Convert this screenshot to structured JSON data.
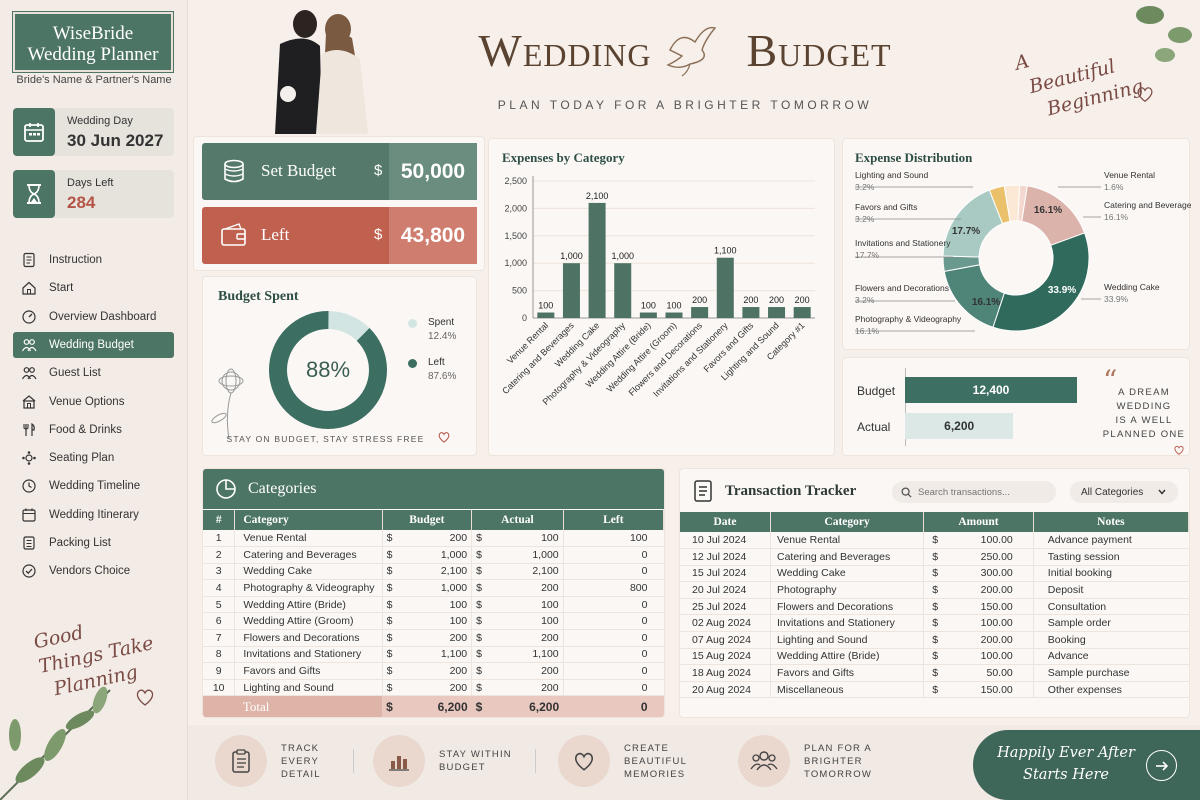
{
  "sidebar": {
    "brand_line1": "WiseBride",
    "brand_line2": "Wedding Planner",
    "names": "Bride's Name & Partner's Name",
    "wedding_day_label": "Wedding Day",
    "wedding_day_value": "30 Jun 2027",
    "days_left_label": "Days Left",
    "days_left_value": "284",
    "nav": [
      {
        "label": "Instruction",
        "icon": "document-icon"
      },
      {
        "label": "Start",
        "icon": "home-icon"
      },
      {
        "label": "Overview Dashboard",
        "icon": "dashboard-icon"
      },
      {
        "label": "Wedding Budget",
        "icon": "people-icon"
      },
      {
        "label": "Guest List",
        "icon": "guest-icon"
      },
      {
        "label": "Venue Options",
        "icon": "venue-icon"
      },
      {
        "label": "Food & Drinks",
        "icon": "cutlery-icon"
      },
      {
        "label": "Seating Plan",
        "icon": "seating-icon"
      },
      {
        "label": "Wedding Timeline",
        "icon": "clock-icon"
      },
      {
        "label": "Wedding Itinerary",
        "icon": "calendar-icon"
      },
      {
        "label": "Packing List",
        "icon": "list-icon"
      },
      {
        "label": "Vendors Choice",
        "icon": "check-icon"
      }
    ],
    "quote_lines": [
      "Good",
      "Things Take",
      "Planning"
    ]
  },
  "header": {
    "title_left": "Wedding",
    "title_right": "Budget",
    "subtitle": "PLAN TODAY FOR A BRIGHTER TOMORROW",
    "tagline_lines": [
      "A",
      "Beautiful",
      "Beginning"
    ]
  },
  "budget": {
    "set_label": "Set Budget",
    "set_currency": "$",
    "set_value": "50,000",
    "left_label": "Left",
    "left_currency": "$",
    "left_value": "43,800"
  },
  "budget_spent": {
    "title": "Budget Spent",
    "percent": "88%",
    "spent_label": "Spent",
    "spent_value": "12.4%",
    "left_label": "Left",
    "left_value": "87.6%",
    "footer": "STAY ON BUDGET, STAY STRESS FREE",
    "donut_fraction_main": 0.876
  },
  "expenses_chart": {
    "title": "Expenses by Category"
  },
  "distribution": {
    "title": "Expense Distribution",
    "left_labels": [
      {
        "name": "Lighting and Sound",
        "pct": "3.2%"
      },
      {
        "name": "Favors and Gifts",
        "pct": "3.2%"
      },
      {
        "name": "Invitations and Stationery",
        "pct": "17.7%"
      },
      {
        "name": "Flowers and Decorations",
        "pct": "3.2%"
      },
      {
        "name": "Photography & Videography",
        "pct": "16.1%"
      }
    ],
    "right_labels": [
      {
        "name": "Venue Rental",
        "pct": "1.6%"
      },
      {
        "name": "Catering and Beverages",
        "pct": "16.1%"
      },
      {
        "name": "Wedding Cake",
        "pct": "33.9%"
      }
    ],
    "inner_labels": [
      "16.1%",
      "17.7%",
      "16.1%",
      "33.9%"
    ]
  },
  "budget_actual": {
    "budget_label": "Budget",
    "budget_value": "12,400",
    "budget_fraction": 1.0,
    "actual_label": "Actual",
    "actual_value": "6,200",
    "actual_fraction": 0.5
  },
  "quote": {
    "lines": [
      "A DREAM",
      "WEDDING",
      "IS A WELL",
      "PLANNED ONE"
    ]
  },
  "categories": {
    "title": "Categories",
    "headers": [
      "#",
      "Category",
      "Budget",
      "Actual",
      "Left"
    ],
    "rows": [
      [
        "1",
        "Venue Rental",
        "$",
        "200",
        "$",
        "100",
        "100"
      ],
      [
        "2",
        "Catering and Beverages",
        "$",
        "1,000",
        "$",
        "1,000",
        "0"
      ],
      [
        "3",
        "Wedding Cake",
        "$",
        "2,100",
        "$",
        "2,100",
        "0"
      ],
      [
        "4",
        "Photography & Videography",
        "$",
        "1,000",
        "$",
        "200",
        "800"
      ],
      [
        "5",
        "Wedding Attire (Bride)",
        "$",
        "100",
        "$",
        "100",
        "0"
      ],
      [
        "6",
        "Wedding Attire (Groom)",
        "$",
        "100",
        "$",
        "100",
        "0"
      ],
      [
        "7",
        "Flowers and Decorations",
        "$",
        "200",
        "$",
        "200",
        "0"
      ],
      [
        "8",
        "Invitations and Stationery",
        "$",
        "1,100",
        "$",
        "1,100",
        "0"
      ],
      [
        "9",
        "Favors and Gifts",
        "$",
        "200",
        "$",
        "200",
        "0"
      ],
      [
        "10",
        "Lighting and Sound",
        "$",
        "200",
        "$",
        "200",
        "0"
      ]
    ],
    "total_label": "Total",
    "total_cur": "$",
    "total_budget": "6,200",
    "total_cur2": "$",
    "total_actual": "6,200",
    "total_left": "0"
  },
  "transactions": {
    "title": "Transaction Tracker",
    "search_placeholder": "Search transactions...",
    "filter_value": "All Categories",
    "headers": [
      "Date",
      "Category",
      "Amount",
      "Notes"
    ],
    "rows": [
      [
        "10 Jul 2024",
        "Venue Rental",
        "$",
        "100.00",
        "Advance payment"
      ],
      [
        "12 Jul 2024",
        "Catering and Beverages",
        "$",
        "250.00",
        "Tasting session"
      ],
      [
        "15 Jul 2024",
        "Wedding Cake",
        "$",
        "300.00",
        "Initial booking"
      ],
      [
        "20 Jul 2024",
        "Photography",
        "$",
        "200.00",
        "Deposit"
      ],
      [
        "25 Jul 2024",
        "Flowers and Decorations",
        "$",
        "150.00",
        "Consultation"
      ],
      [
        "02 Aug 2024",
        "Invitations and Stationery",
        "$",
        "100.00",
        "Sample order"
      ],
      [
        "07 Aug 2024",
        "Lighting and Sound",
        "$",
        "200.00",
        "Booking"
      ],
      [
        "15 Aug 2024",
        "Wedding Attire (Bride)",
        "$",
        "100.00",
        "Advance"
      ],
      [
        "18 Aug 2024",
        "Favors and Gifts",
        "$",
        "50.00",
        "Sample purchase"
      ],
      [
        "20 Aug 2024",
        "Miscellaneous",
        "$",
        "150.00",
        "Other expenses"
      ]
    ]
  },
  "footer": {
    "items": [
      {
        "line1": "TRACK EVERY",
        "line2": "DETAIL"
      },
      {
        "line1": "STAY WITHIN",
        "line2": "BUDGET"
      },
      {
        "line1": "CREATE BEAUTIFUL",
        "line2": "MEMORIES"
      },
      {
        "line1": "PLAN FOR A BRIGHTER",
        "line2": "TOMORROW"
      }
    ],
    "cta_line1": "Happily Ever After",
    "cta_line2": "Starts Here"
  },
  "colors": {
    "green": "#4d7566",
    "terracotta": "#c0604f",
    "blush": "#e8c8bf"
  },
  "chart_data": [
    {
      "type": "bar",
      "title": "Expenses by Category",
      "categories": [
        "Venue Rental",
        "Catering and Beverages",
        "Wedding Cake",
        "Photography & Videography",
        "Wedding Attire (Bride)",
        "Wedding Attire (Groom)",
        "Flowers and Decorations",
        "Invitations and Stationery",
        "Favors and Gifts",
        "Lighting and Sound",
        "Category #1"
      ],
      "values": [
        100,
        1000,
        2100,
        1000,
        100,
        100,
        200,
        1100,
        200,
        200,
        200
      ],
      "yticks": [
        "0",
        "500",
        "1,000",
        "1,500",
        "2,000",
        "2,500"
      ],
      "ylim": [
        0,
        2500
      ]
    },
    {
      "type": "pie",
      "title": "Expense Distribution",
      "labels": [
        "Venue Rental",
        "Catering and Beverages",
        "Wedding Cake",
        "Photography & Videography",
        "Flowers and Decorations",
        "Invitations and Stationery",
        "Favors and Gifts",
        "Lighting and Sound"
      ],
      "values": [
        1.6,
        16.1,
        33.9,
        16.1,
        3.2,
        17.7,
        3.2,
        3.2
      ]
    }
  ]
}
